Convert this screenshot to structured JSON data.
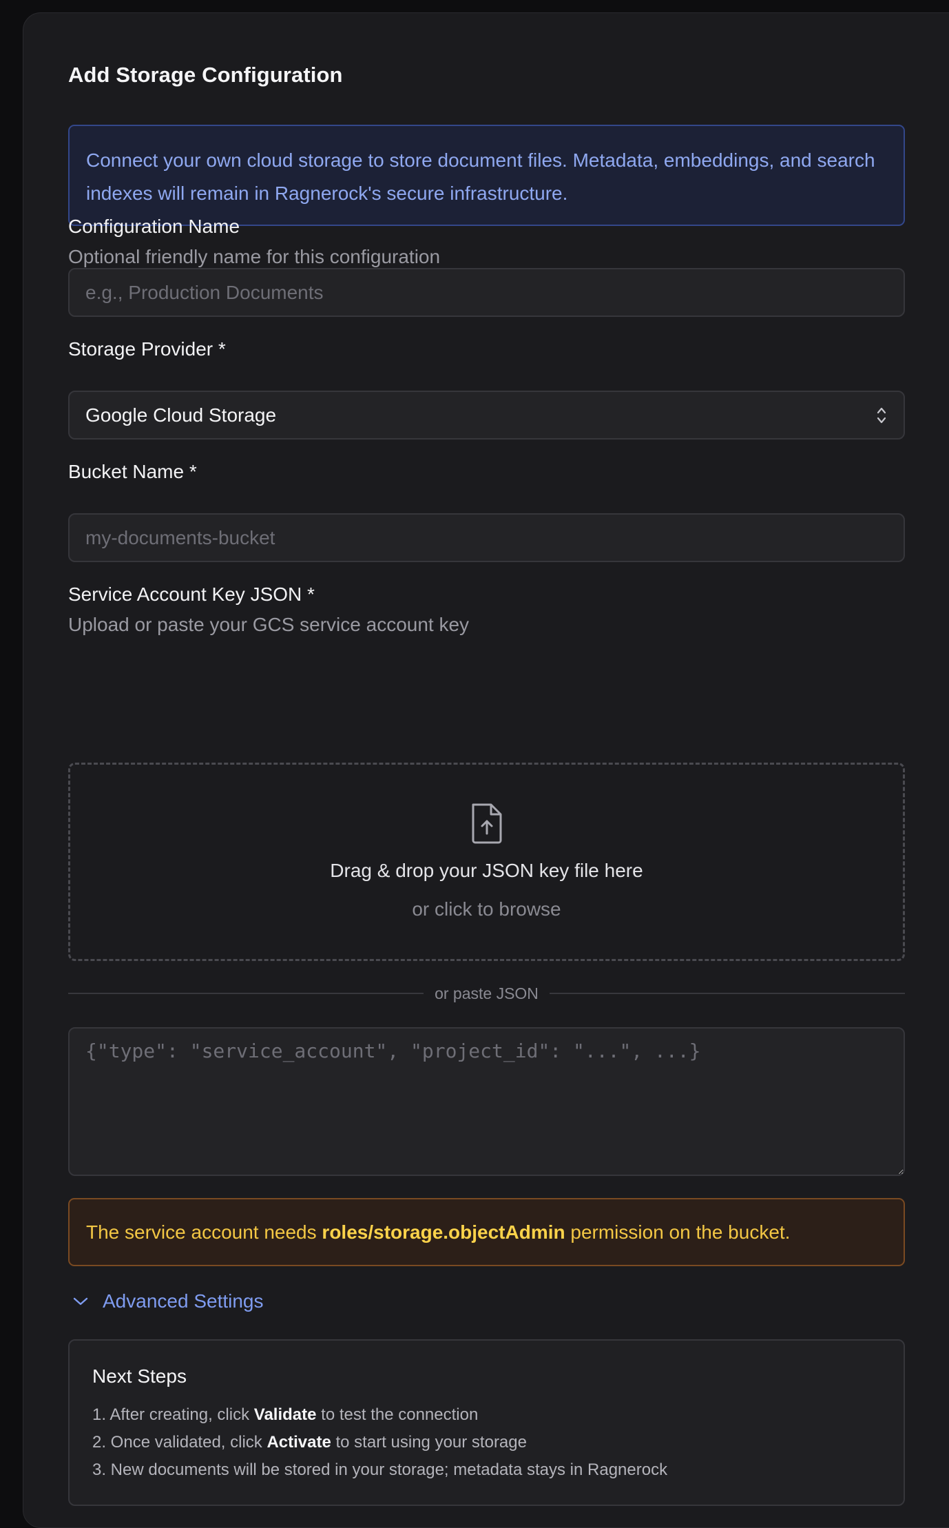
{
  "title": "Add Storage Configuration",
  "info": "Connect your own cloud storage to store document files. Metadata, embeddings, and search indexes will remain in Ragnerock's secure infrastructure.",
  "config_name": {
    "label": "Configuration Name",
    "hint": "Optional friendly name for this configuration",
    "placeholder": "e.g., Production Documents",
    "value": ""
  },
  "provider": {
    "label": "Storage Provider *",
    "selected": "Google Cloud Storage"
  },
  "bucket": {
    "label": "Bucket Name *",
    "placeholder": "my-documents-bucket",
    "value": ""
  },
  "service_key": {
    "label": "Service Account Key JSON *",
    "hint": "Upload or paste your GCS service account key",
    "dropzone_main": "Drag & drop your JSON key file here",
    "dropzone_sub": "or click to browse",
    "divider": "or paste JSON",
    "json_placeholder": "{\"type\": \"service_account\", \"project_id\": \"...\", ...}"
  },
  "warning": {
    "prefix": "The service account needs ",
    "role": "roles/storage.objectAdmin",
    "suffix": " permission on the bucket."
  },
  "advanced": {
    "label": "Advanced Settings"
  },
  "next_steps": {
    "title": "Next Steps",
    "items": [
      {
        "before": "1. After creating, click ",
        "bold": "Validate",
        "after": " to test the connection"
      },
      {
        "before": "2. Once validated, click ",
        "bold": "Activate",
        "after": " to start using your storage"
      },
      {
        "before": "3. New documents will be stored in your storage; metadata stays in Ragnerock",
        "bold": "",
        "after": ""
      }
    ]
  },
  "colors": {
    "accent": "#7f9cf0",
    "info_bg": "#1c2136",
    "warning_text": "#f3c744",
    "warning_bg": "#2c1f18"
  }
}
